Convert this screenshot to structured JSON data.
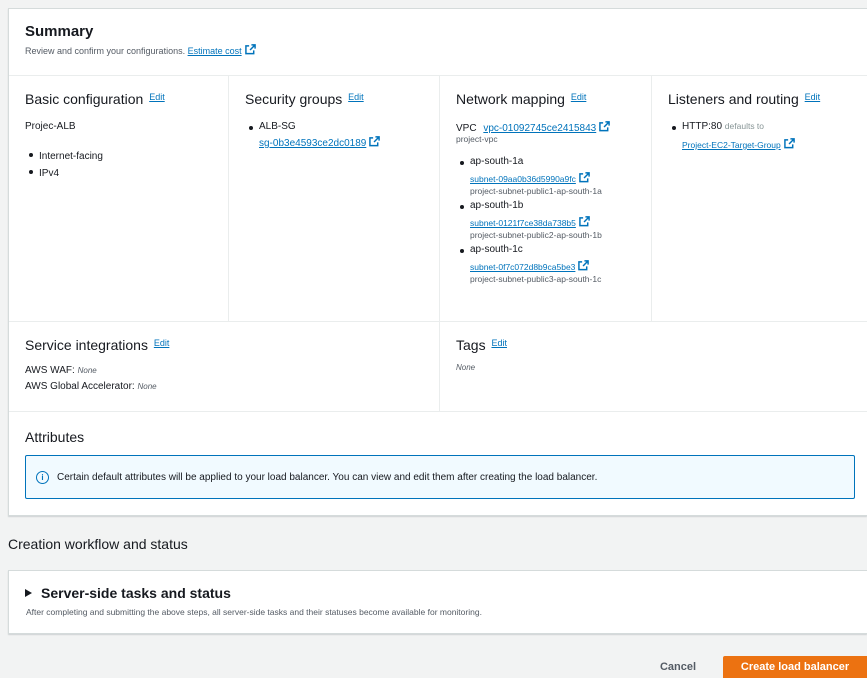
{
  "summary": {
    "title": "Summary",
    "subtitle": "Review and confirm your configurations.",
    "estimate_cost": "Estimate cost"
  },
  "edit_label": "Edit",
  "basic": {
    "title": "Basic configuration",
    "name": "Projec-ALB",
    "items": [
      "Internet-facing",
      "IPv4"
    ]
  },
  "security": {
    "title": "Security groups",
    "group_name": "ALB-SG",
    "group_id": "sg-0b3e4593ce2dc0189"
  },
  "network": {
    "title": "Network mapping",
    "vpc_label": "VPC",
    "vpc_id": "vpc-01092745ce2415843",
    "vpc_name": "project-vpc",
    "zones": [
      {
        "az": "ap-south-1a",
        "subnet": "subnet-09aa0b36d5990a9fc",
        "subnet_name": "project-subnet-public1-ap-south-1a"
      },
      {
        "az": "ap-south-1b",
        "subnet": "subnet-0121f7ce38da738b5",
        "subnet_name": "project-subnet-public2-ap-south-1b"
      },
      {
        "az": "ap-south-1c",
        "subnet": "subnet-0f7c072d8b9ca5be3",
        "subnet_name": "project-subnet-public3-ap-south-1c"
      }
    ]
  },
  "listeners": {
    "title": "Listeners and routing",
    "protocol": "HTTP:80",
    "defaults_to": "defaults to",
    "target_group": "Project-EC2-Target-Group"
  },
  "service": {
    "title": "Service integrations",
    "waf_label": "AWS WAF:",
    "waf_value": "None",
    "ga_label": "AWS Global Accelerator:",
    "ga_value": "None"
  },
  "tags": {
    "title": "Tags",
    "value": "None"
  },
  "attributes": {
    "title": "Attributes",
    "info": "Certain default attributes will be applied to your load balancer. You can view and edit them after creating the load balancer."
  },
  "workflow": {
    "title": "Creation workflow and status"
  },
  "tasks": {
    "title": "Server-side tasks and status",
    "subtitle": "After completing and submitting the above steps, all server-side tasks and their statuses become available for monitoring."
  },
  "footer": {
    "cancel": "Cancel",
    "create": "Create load balancer"
  },
  "colors": {
    "link": "#0073bb",
    "primary": "#ec7211",
    "info_bg": "#f1faff"
  },
  "icons": {
    "external": "external-link-icon",
    "info": "info-icon",
    "caret": "caret-right-icon"
  }
}
